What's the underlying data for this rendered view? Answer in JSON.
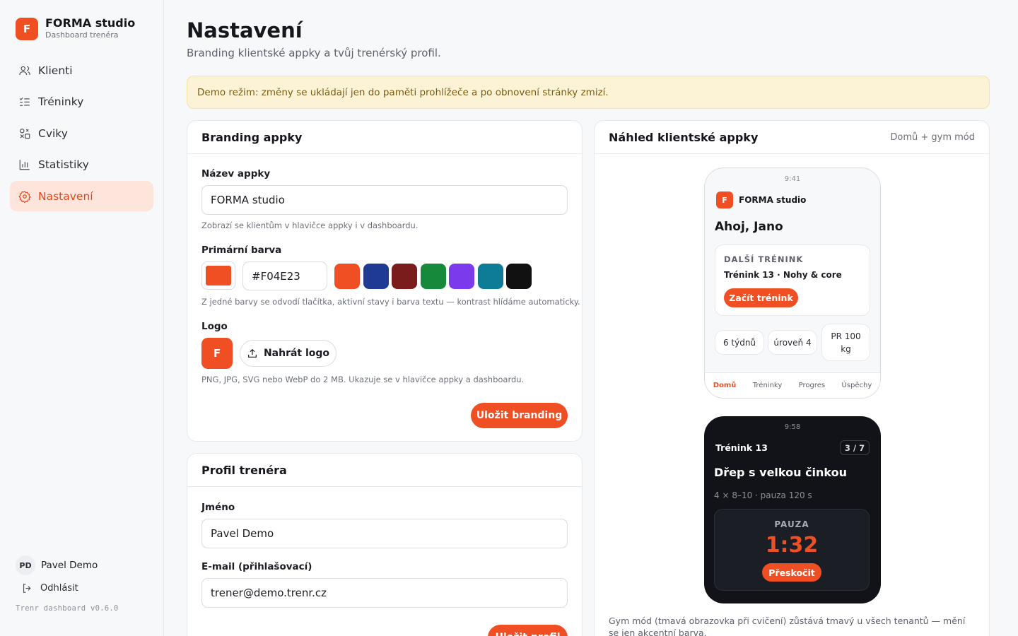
{
  "brand": {
    "initial": "F",
    "name": "FORMA studio",
    "subtitle": "Dashboard trenéra",
    "color": "#F04E23"
  },
  "nav": [
    {
      "label": "Klienti",
      "icon": "users-icon"
    },
    {
      "label": "Tréninky",
      "icon": "checklist-icon"
    },
    {
      "label": "Cviky",
      "icon": "shapes-icon"
    },
    {
      "label": "Statistiky",
      "icon": "bar-chart-icon"
    },
    {
      "label": "Nastavení",
      "icon": "gear-icon",
      "active": true
    }
  ],
  "user": {
    "initials": "PD",
    "name": "Pavel Demo",
    "logout": "Odhlásit"
  },
  "version": "Trenr dashboard v0.6.0",
  "page": {
    "title": "Nastavení",
    "subtitle": "Branding klientské appky a tvůj trenérský profil.",
    "banner": "Demo režim: změny se ukládají jen do paměti prohlížeče a po obnovení stránky zmizí."
  },
  "branding": {
    "title": "Branding appky",
    "app_name_label": "Název appky",
    "app_name_value": "FORMA studio",
    "app_name_hint": "Zobrazí se klientům v hlavičce appky i v dashboardu.",
    "color_label": "Primární barva",
    "color_value": "#F04E23",
    "swatches": [
      "#F04E23",
      "#1F3A93",
      "#7A1C1C",
      "#168A3A",
      "#7C3AED",
      "#0F7C97",
      "#111111"
    ],
    "color_hint": "Z jedné barvy se odvodí tlačítka, aktivní stavy i barva textu — kontrast hlídáme automaticky.",
    "logo_label": "Logo",
    "logo_initial": "F",
    "upload_label": "Nahrát logo",
    "logo_hint": "PNG, JPG, SVG nebo WebP do 2 MB. Ukazuje se v hlavičce appky a dashboardu.",
    "save_label": "Uložit branding"
  },
  "profile": {
    "title": "Profil trenéra",
    "name_label": "Jméno",
    "name_value": "Pavel Demo",
    "email_label": "E-mail (přihlašovací)",
    "email_value": "trener@demo.trenr.cz",
    "save_label": "Uložit profil"
  },
  "preview": {
    "title": "Náhled klientské appky",
    "note": "Domů + gym mód",
    "home": {
      "time": "9:41",
      "brand_initial": "F",
      "brand_name": "FORMA studio",
      "greeting": "Ahoj, Jano",
      "next_kicker": "DALŠÍ TRÉNINK",
      "next_title": "Trénink 13 · Nohy & core",
      "start_label": "Začít trénink",
      "chips": [
        "6 týdnů",
        "úroveň 4",
        "PR 100 kg"
      ],
      "tabs": [
        "Domů",
        "Tréninky",
        "Progres",
        "Úspěchy"
      ]
    },
    "gym": {
      "time": "9:58",
      "workout": "Trénink 13",
      "progress": "3 / 7",
      "exercise": "Dřep s velkou činkou",
      "meta": "4 × 8–10 · pauza 120 s",
      "pause_label": "PAUZA",
      "timer": "1:32",
      "skip_label": "Přeskočit"
    },
    "footnote": "Gym mód (tmavá obrazovka při cvičení) zůstává tmavý u všech tenantů — mění se jen akcentní barva."
  }
}
